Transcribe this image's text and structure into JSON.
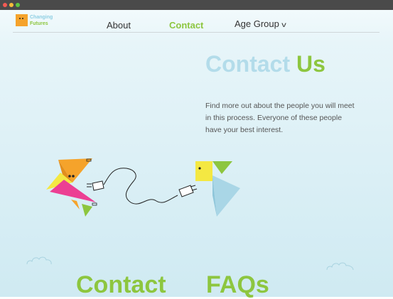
{
  "window": {
    "controls": [
      "close",
      "minimize",
      "maximize"
    ]
  },
  "logo": {
    "line1": "Changing",
    "line2": "Futures"
  },
  "nav": {
    "about": "About",
    "contact": "Contact",
    "age_group": "Age Group"
  },
  "hero": {
    "title_part1": "Contact",
    "title_part2": "Us",
    "description": "Find more out about the people you will meet in this process. Everyone of these people have your best interest."
  },
  "sections": {
    "contact": "Contact",
    "faqs": "FAQs"
  },
  "colors": {
    "accent_green": "#8dc63f",
    "accent_blue": "#b3dcea",
    "logo_orange": "#f5a32b"
  }
}
